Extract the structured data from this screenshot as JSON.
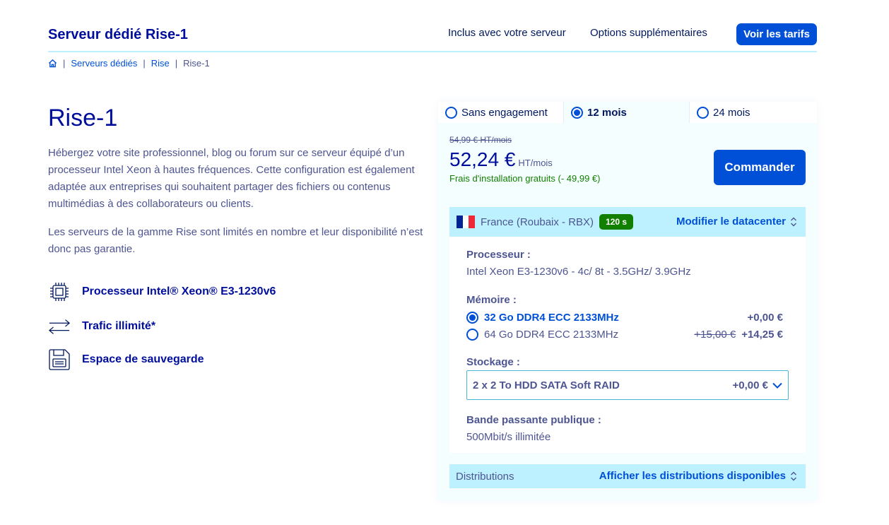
{
  "topnav": {
    "title": "Serveur dédié Rise-1",
    "links": [
      "Inclus avec votre serveur",
      "Options supplémentaires"
    ],
    "cta": "Voir les tarifs"
  },
  "breadcrumb": {
    "items": [
      "Serveurs dédiés",
      "Rise"
    ],
    "current": "Rise-1",
    "separator": "|"
  },
  "hero": {
    "title": "Rise-1",
    "paragraphs": [
      "Hébergez votre site professionnel, blog ou forum sur ce serveur équipé d’un processeur Intel Xeon à hautes fréquences. Cette configuration est également adaptée aux entreprises qui souhaitent partager des fichiers ou contenus multimédias à des collaborateurs ou clients.",
      "Les serveurs de la gamme Rise sont limités en nombre et leur disponibilité n’est donc pas garantie."
    ],
    "features": [
      {
        "icon": "cpu-icon",
        "label": "Processeur Intel® Xeon® E3-1230v6"
      },
      {
        "icon": "arrows-icon",
        "label": "Trafic illimité*"
      },
      {
        "icon": "backup-icon",
        "label": "Espace de sauvegarde"
      }
    ]
  },
  "offer": {
    "tabs": [
      {
        "label": "Sans engagement",
        "selected": false
      },
      {
        "label": "12 mois",
        "selected": true
      },
      {
        "label": "24 mois",
        "selected": false
      }
    ],
    "old_price": "54,99 € HT/mois",
    "price": "52,24 €",
    "price_unit": "HT/mois",
    "setup_fee": "Frais d'installation gratuits (- 49,99 €)",
    "order_label": "Commander",
    "datacenter": {
      "name": "France (Roubaix - RBX)",
      "badge": "120 s",
      "change_label": "Modifier le datacenter",
      "flag_colors": [
        "#002395",
        "#ffffff",
        "#ed2939"
      ]
    },
    "processor": {
      "label": "Processeur :",
      "value": "Intel Xeon E3-1230v6 - 4c/ 8t - 3.5GHz/ 3.9GHz"
    },
    "memory": {
      "label": "Mémoire :",
      "options": [
        {
          "label": "32 Go DDR4 ECC 2133MHz",
          "selected": true,
          "old": "",
          "delta": "+0,00 €"
        },
        {
          "label": "64 Go DDR4 ECC 2133MHz",
          "selected": false,
          "old": "+15,00 €",
          "delta": "+14,25 €"
        }
      ]
    },
    "storage": {
      "label": "Stockage :",
      "value": "2 x 2 To HDD SATA Soft RAID",
      "delta": "+0,00 €"
    },
    "bandwidth": {
      "label": "Bande passante publique :",
      "value": "500Mbit/s illimitée"
    },
    "distributions": {
      "label": "Distributions",
      "link": "Afficher les distributions disponibles"
    }
  },
  "colors": {
    "brand": "#000e9c",
    "accent": "#0050d7",
    "highlight": "#bef1ff",
    "success": "#118000"
  }
}
